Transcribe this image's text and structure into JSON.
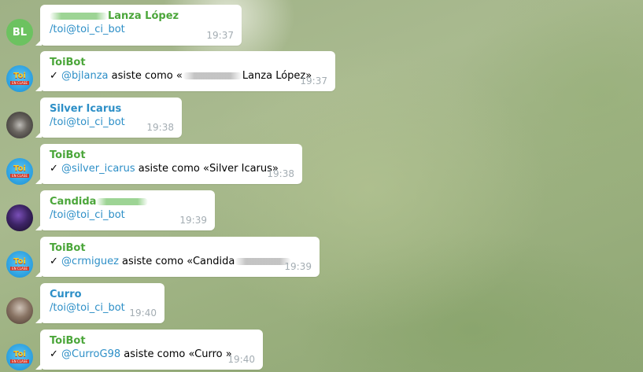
{
  "messages": [
    {
      "sender": "Lanza López",
      "text": "/toi@toi_ci_bot",
      "time": "19:37",
      "avatar_initials": "BL"
    },
    {
      "sender": "ToiBot",
      "check": "✓",
      "mention": "@bjlanza",
      "text_mid": " asiste como «",
      "text_name": "Lanza López»",
      "time": "19:37"
    },
    {
      "sender": "Silver Icarus",
      "text": "/toi@toi_ci_bot",
      "time": "19:38"
    },
    {
      "sender": "ToiBot",
      "check": "✓",
      "mention": "@silver_icarus",
      "text_mid": " asiste como «Silver Icarus»",
      "time": "19:38"
    },
    {
      "sender": "Candida",
      "text": "/toi@toi_ci_bot",
      "time": "19:39"
    },
    {
      "sender": "ToiBot",
      "check": "✓",
      "mention": "@crmiguez",
      "text_mid": " asiste como «Candida",
      "time": "19:39"
    },
    {
      "sender": "Curro",
      "text": "/toi@toi_ci_bot",
      "time": "19:40"
    },
    {
      "sender": "ToiBot",
      "check": "✓",
      "mention": "@CurroG98",
      "text_mid": " asiste como «Curro »",
      "time": "19:40"
    }
  ],
  "bot_avatar": {
    "line1": "Toi",
    "line2": "EN CLASE"
  },
  "colors": {
    "sender_green": "#4ba63a",
    "sender_blue": "#2d8fc7",
    "link": "#2d8fc7",
    "time": "#a4adb3",
    "avatar_bl": "#6cc260"
  }
}
